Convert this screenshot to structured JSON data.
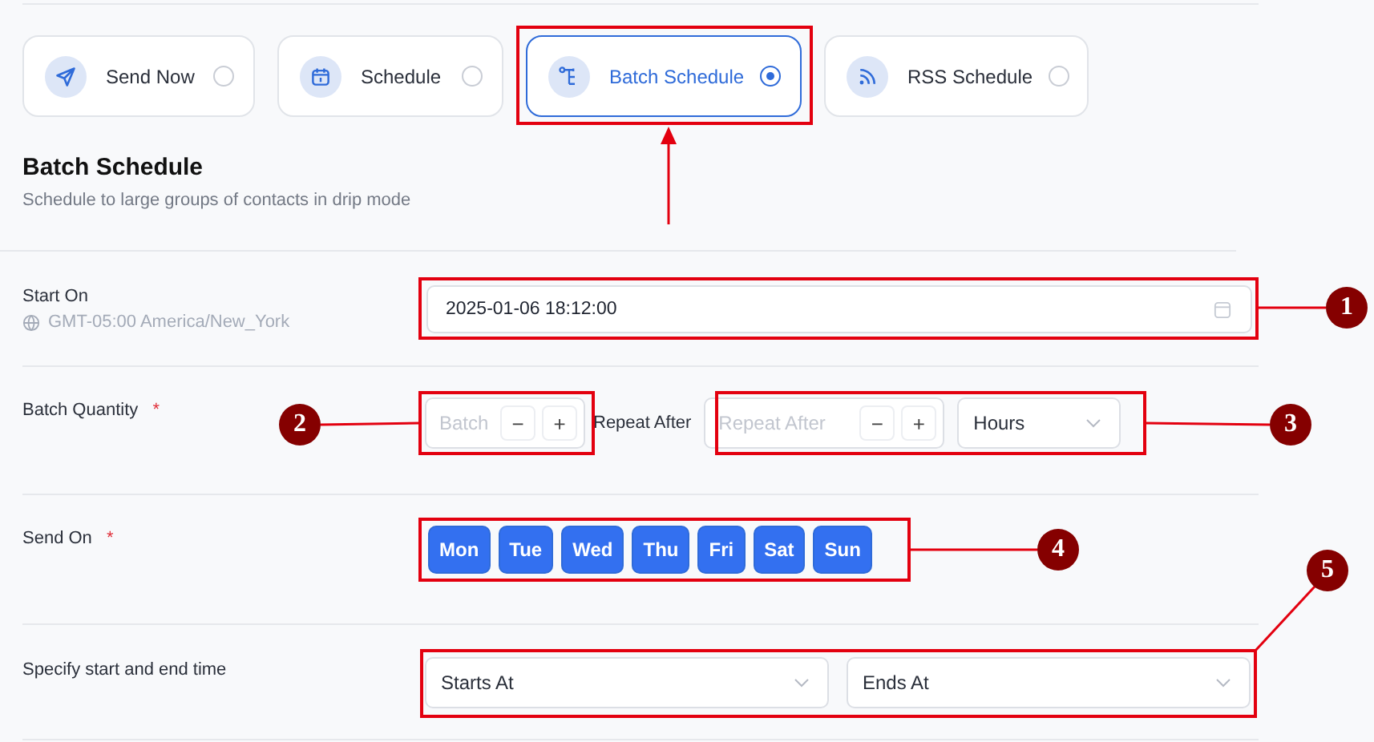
{
  "modes": [
    {
      "label": "Send Now",
      "selected": false
    },
    {
      "label": "Schedule",
      "selected": false
    },
    {
      "label": "Batch Schedule",
      "selected": true
    },
    {
      "label": "RSS Schedule",
      "selected": false
    }
  ],
  "section": {
    "title": "Batch Schedule",
    "subtitle": "Schedule to large groups of contacts in drip mode"
  },
  "start_on": {
    "label": "Start On",
    "timezone": "GMT-05:00 America/New_York",
    "value": "2025-01-06 18:12:00"
  },
  "batch_quantity": {
    "label": "Batch Quantity",
    "required_mark": "*",
    "batch": {
      "placeholder": "Batch",
      "decrement": "−",
      "increment": "+"
    },
    "repeat_label": "Repeat After",
    "repeat": {
      "placeholder": "Repeat After",
      "decrement": "−",
      "increment": "+"
    },
    "unit": {
      "value": "Hours"
    }
  },
  "send_on": {
    "label": "Send On",
    "required_mark": "*",
    "days": [
      {
        "label": "Mon",
        "selected": true
      },
      {
        "label": "Tue",
        "selected": true
      },
      {
        "label": "Wed",
        "selected": true
      },
      {
        "label": "Thu",
        "selected": true
      },
      {
        "label": "Fri",
        "selected": true
      },
      {
        "label": "Sat",
        "selected": true
      },
      {
        "label": "Sun",
        "selected": true
      }
    ]
  },
  "time_range": {
    "label": "Specify start and end time",
    "start": {
      "placeholder": "Starts At"
    },
    "end": {
      "placeholder": "Ends At"
    }
  },
  "callouts": [
    "1",
    "2",
    "3",
    "4",
    "5"
  ]
}
